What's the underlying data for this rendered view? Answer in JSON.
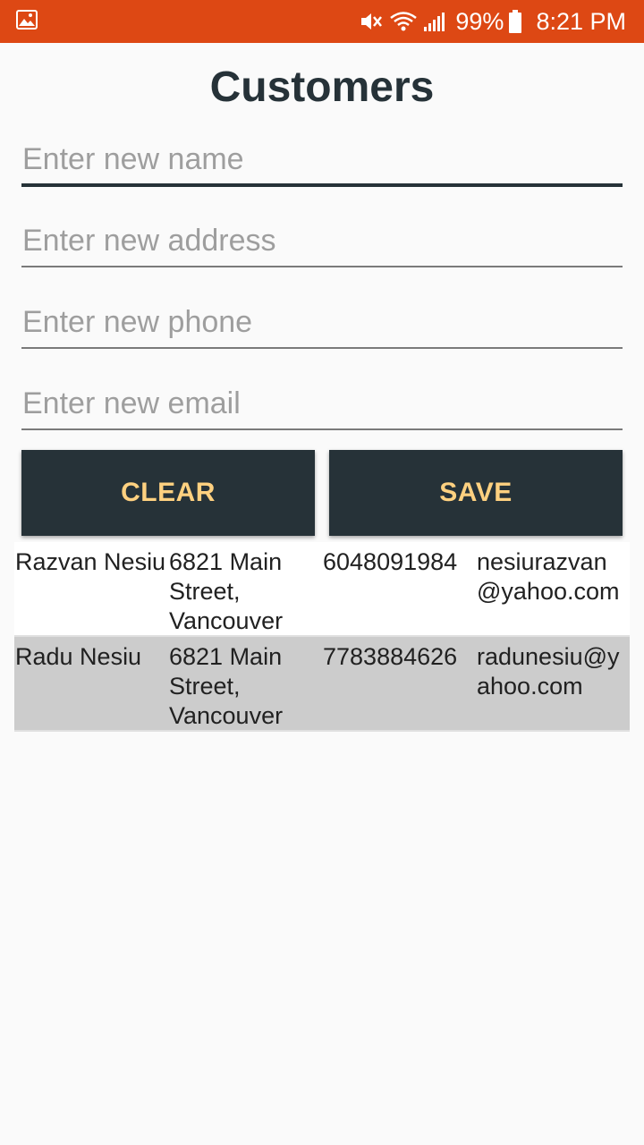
{
  "status_bar": {
    "color": "#dd4814",
    "left_icon": "image-icon",
    "icons": [
      "mute-icon",
      "wifi-icon",
      "signal-icon",
      "battery-icon"
    ],
    "battery": "99%",
    "time": "8:21 PM"
  },
  "page": {
    "title": "Customers"
  },
  "form": {
    "name_placeholder": "Enter new name",
    "address_placeholder": "Enter new address",
    "phone_placeholder": "Enter new phone",
    "email_placeholder": "Enter new email"
  },
  "buttons": {
    "clear_label": "CLEAR",
    "save_label": "SAVE",
    "background": "#263238",
    "text_color": "#ffd180"
  },
  "customers": [
    {
      "name": "Razvan Nesiu",
      "address": "6821 Main Street, Vancouver",
      "phone": "6048091984",
      "email": "nesiurazvan@yahoo.com"
    },
    {
      "name": "Radu Nesiu",
      "address": "6821 Main Street, Vancouver",
      "phone": "7783884626",
      "email": "radunesiu@yahoo.com"
    }
  ]
}
